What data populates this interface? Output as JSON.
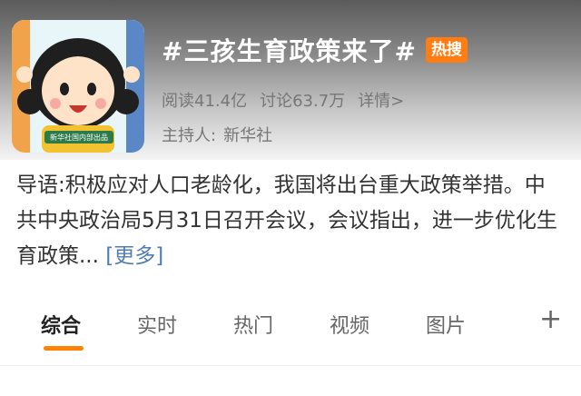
{
  "topic": {
    "title": "#三孩生育政策来了#",
    "hot_badge": "热搜",
    "read_label": "阅读41.4亿",
    "discuss_label": "讨论63.7万",
    "detail_link": "详情>",
    "host_label": "主持人:",
    "host_name": "新华社",
    "cover_caption": "新华社国内部出品"
  },
  "intro": {
    "text": "导语:积极应对人口老龄化，我国将出台重大政策举措。中共中央政治局5月31日召开会议，会议指出，进一步优化生育政策...",
    "more_label": "[更多]"
  },
  "tabs": [
    {
      "label": "综合",
      "active": true
    },
    {
      "label": "实时",
      "active": false
    },
    {
      "label": "热门",
      "active": false
    },
    {
      "label": "视频",
      "active": false
    },
    {
      "label": "图片",
      "active": false
    }
  ],
  "tab_more_icon": "plus-icon",
  "colors": {
    "hot_badge": "#ff7d12",
    "active_tab_indicator": "#ff8200",
    "link_blue": "#507daf"
  }
}
